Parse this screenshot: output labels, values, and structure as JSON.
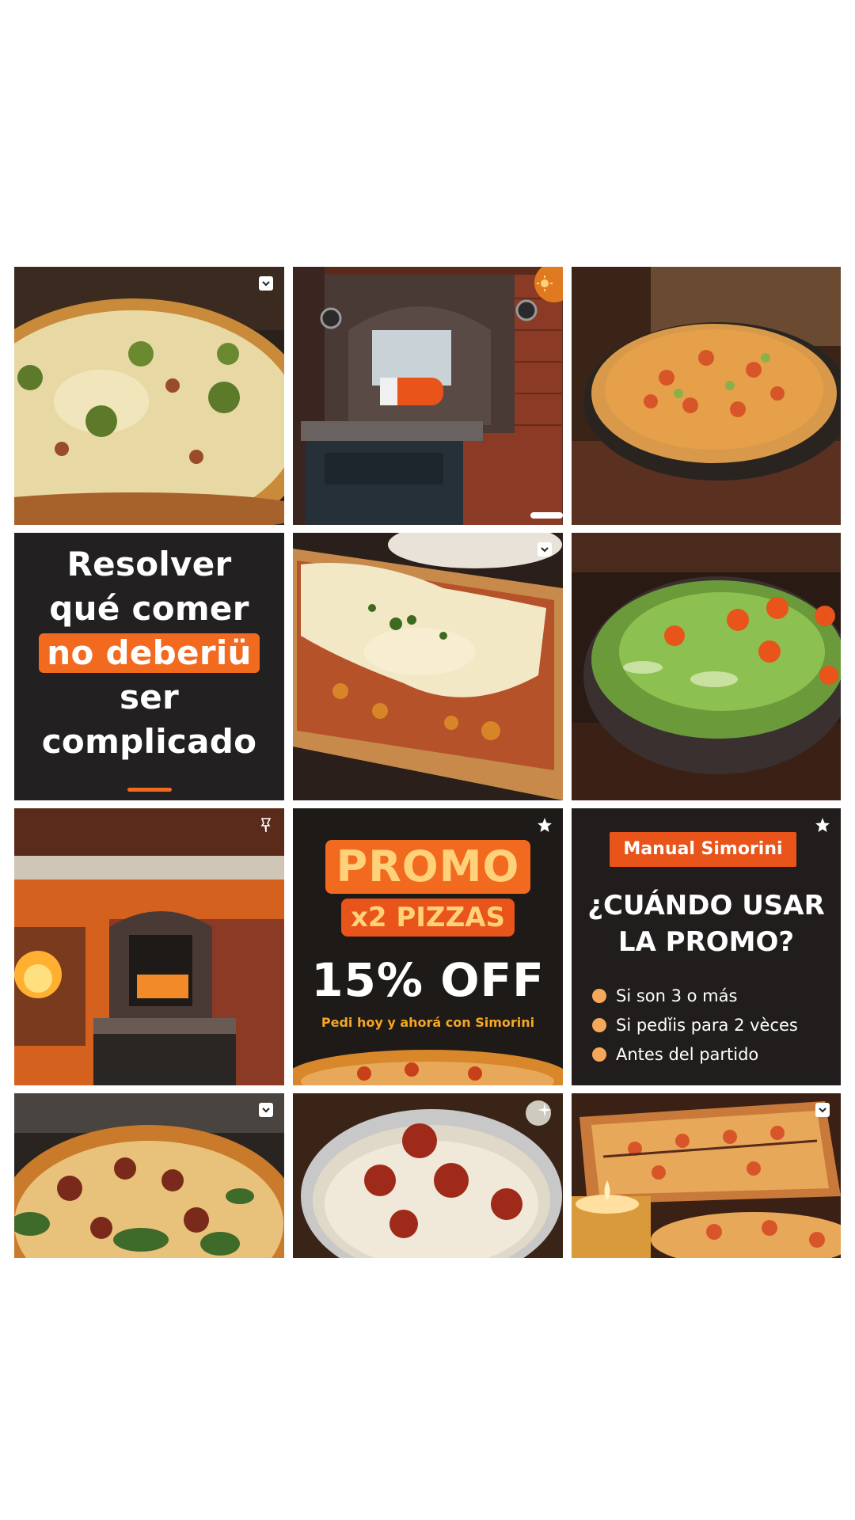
{
  "colors": {
    "accent": "#f26a1f",
    "dark_tile": "#222020",
    "gold_text": "#f5a623"
  },
  "tiles": [
    {
      "id": 1,
      "kind": "photo",
      "subject": "pizza with olives",
      "icon": "bookmark-icon"
    },
    {
      "id": 2,
      "kind": "photo",
      "subject": "brick pizza oven",
      "icon": "sun-icon"
    },
    {
      "id": 3,
      "kind": "photo",
      "subject": "pizza on pan"
    },
    {
      "id": 4,
      "kind": "text"
    },
    {
      "id": 5,
      "kind": "photo",
      "subject": "cheese flatbread",
      "icon": "bookmark-icon"
    },
    {
      "id": 6,
      "kind": "photo",
      "subject": "salad bowl"
    },
    {
      "id": 7,
      "kind": "photo",
      "subject": "pizza oven with fire",
      "icon": "pin-icon"
    },
    {
      "id": 8,
      "kind": "promo",
      "icon": "star-icon"
    },
    {
      "id": 9,
      "kind": "manual",
      "icon": "star-icon"
    },
    {
      "id": 10,
      "kind": "photo",
      "subject": "pizza with greens",
      "icon": "bookmark-icon"
    },
    {
      "id": 11,
      "kind": "photo",
      "subject": "pizza with meat",
      "icon": "sparkle-icon"
    },
    {
      "id": 12,
      "kind": "photo",
      "subject": "rectangular pizza and candle",
      "icon": "bookmark-icon"
    }
  ],
  "resolver": {
    "line1": "Resolver",
    "line2": "qué comer",
    "line3": "no deberiü",
    "line4": "ser complicado"
  },
  "promo": {
    "title": "PROMO",
    "subtitle": "x2 PIZZAS",
    "discount": "15% OFF",
    "caption": "Pedi hoy y ahorá con Simorini"
  },
  "manual": {
    "badge": "Manual Simorini",
    "question_line1": "¿CUÁNDO USAR",
    "question_line2": "LA PROMO?",
    "items": [
      "Si son 3 o más",
      "Si pedǐis para 2 vèces",
      "Antes del partido"
    ]
  }
}
